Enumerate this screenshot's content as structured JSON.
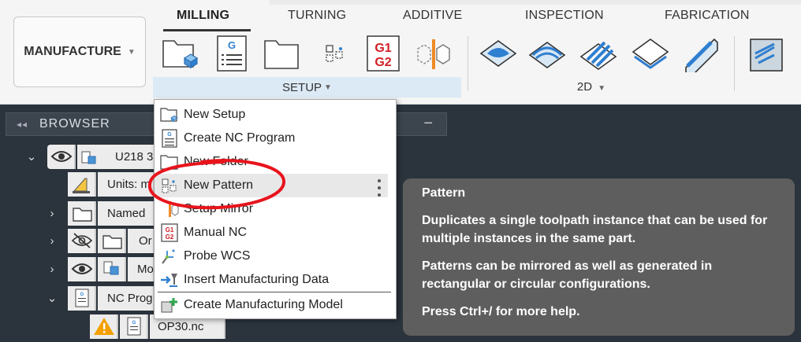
{
  "workspace": {
    "label": "MANUFACTURE"
  },
  "tabs": [
    "MILLING",
    "TURNING",
    "ADDITIVE",
    "INSPECTION",
    "FABRICATION"
  ],
  "ribbon": {
    "setup_group_label": "SETUP",
    "twod_group_label": "2D",
    "g_letter": "G",
    "g1_label": "G1",
    "g2_label": "G2"
  },
  "browser": {
    "title": "BROWSER",
    "rows": [
      {
        "label": "U218 3"
      },
      {
        "label": "Units: m"
      },
      {
        "label": "Named"
      },
      {
        "label": "Or"
      },
      {
        "label": "Mo"
      },
      {
        "label": "NC Prog"
      },
      {
        "label": "OP30.nc"
      }
    ]
  },
  "menu": {
    "items": [
      {
        "label": "New Setup",
        "icon": "new-setup-icon"
      },
      {
        "label": "Create NC Program",
        "icon": "nc-program-icon"
      },
      {
        "label": "New Folder",
        "icon": "folder-icon"
      },
      {
        "label": "New Pattern",
        "icon": "pattern-icon"
      },
      {
        "label": "Setup Mirror",
        "icon": "mirror-icon"
      },
      {
        "label": "Manual NC",
        "icon": "manual-nc-icon"
      },
      {
        "label": "Probe WCS",
        "icon": "probe-icon"
      },
      {
        "label": "Insert Manufacturing Data",
        "icon": "insert-data-icon"
      },
      {
        "label": "Create Manufacturing Model",
        "icon": "manufacturing-model-icon"
      }
    ]
  },
  "tooltip": {
    "title": "Pattern",
    "line1": "Duplicates a single toolpath instance that can be used for multiple instances in the same part.",
    "line2": "Patterns can be mirrored as well as generated in rectangular or circular configurations.",
    "line3": "Press Ctrl+/ for more help."
  },
  "colors": {
    "accent_blue": "#2f7fd0",
    "annotation_red": "#e8141c",
    "warning": "#f4a000",
    "tooltip_bg": "#5e5e5e"
  }
}
